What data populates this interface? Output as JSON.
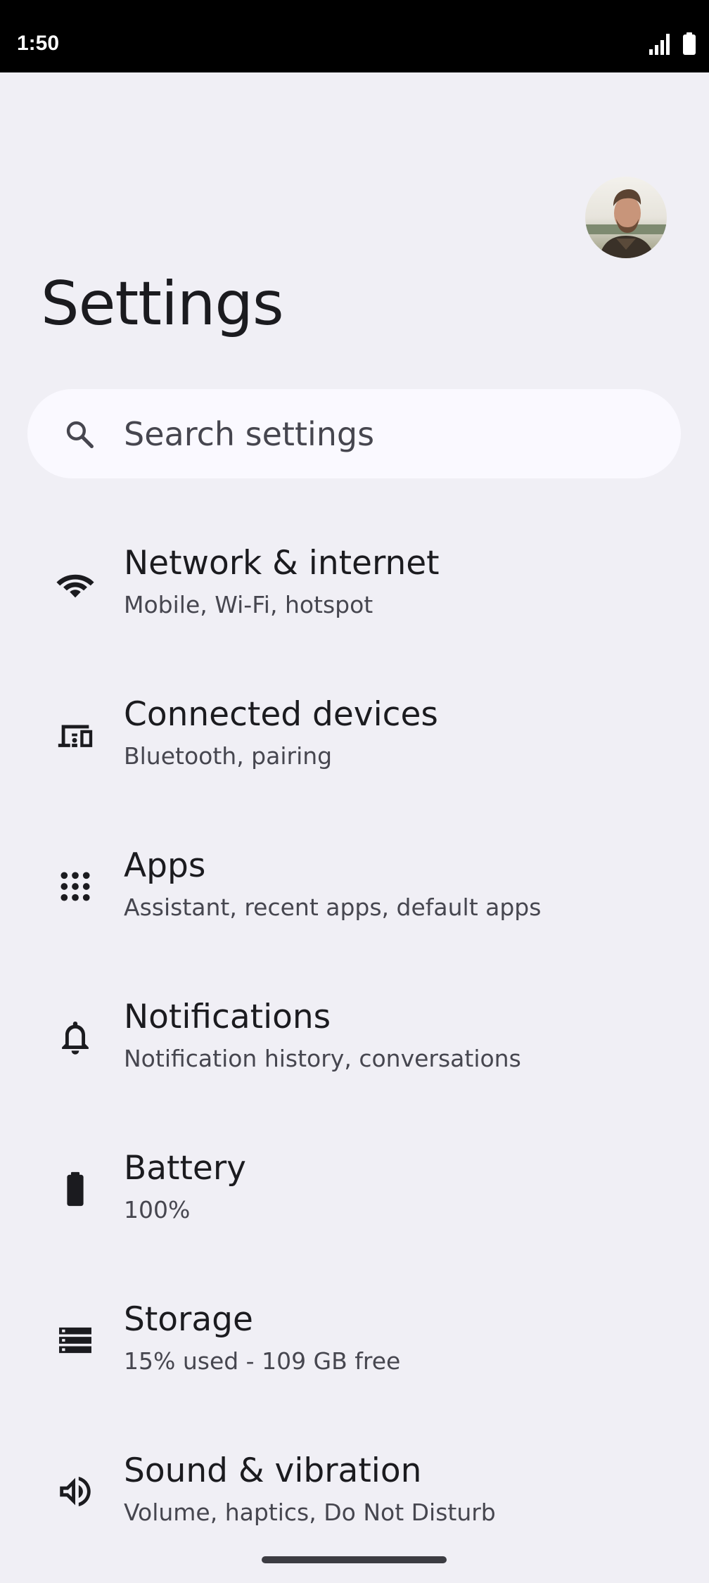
{
  "status_bar": {
    "time": "1:50"
  },
  "header": {
    "title": "Settings"
  },
  "search": {
    "placeholder": "Search settings"
  },
  "settings_items": [
    {
      "title": "Network & internet",
      "subtitle": "Mobile, Wi-Fi, hotspot",
      "icon": "wifi-icon"
    },
    {
      "title": "Connected devices",
      "subtitle": "Bluetooth, pairing",
      "icon": "connected-devices-icon"
    },
    {
      "title": "Apps",
      "subtitle": "Assistant, recent apps, default apps",
      "icon": "apps-grid-icon"
    },
    {
      "title": "Notifications",
      "subtitle": "Notification history, conversations",
      "icon": "bell-icon"
    },
    {
      "title": "Battery",
      "subtitle": "100%",
      "icon": "battery-icon"
    },
    {
      "title": "Storage",
      "subtitle": "15% used - 109 GB free",
      "icon": "storage-icon"
    },
    {
      "title": "Sound & vibration",
      "subtitle": "Volume, haptics, Do Not Disturb",
      "icon": "speaker-icon"
    }
  ],
  "colors": {
    "background": "#F0EFF5",
    "search_background": "#FAF9FF",
    "text_primary": "#1B1B1F",
    "text_secondary": "#46464F",
    "status_bar": "#000000"
  }
}
